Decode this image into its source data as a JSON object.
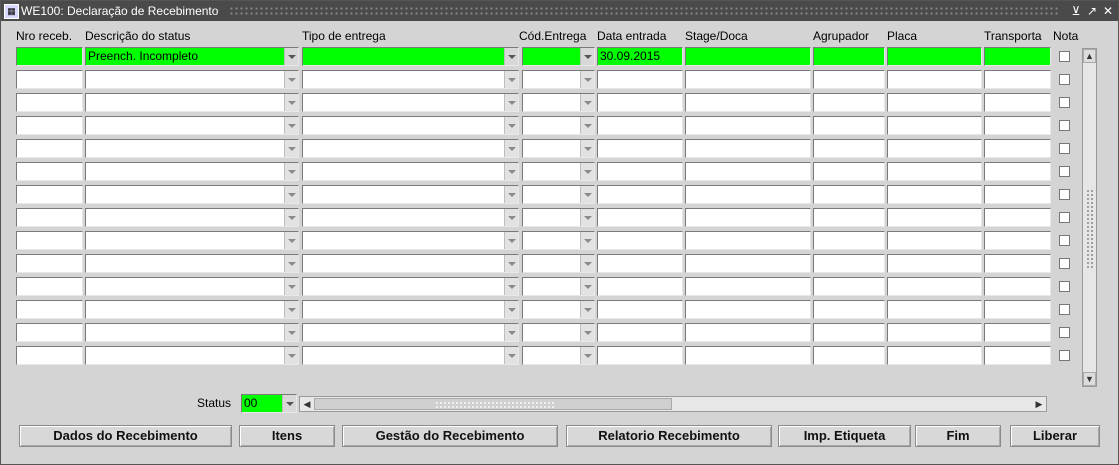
{
  "window": {
    "title": "WE100: Declaração de Recebimento",
    "app_icon": "form-icon",
    "controls": [
      "minimize-icon",
      "restore-icon",
      "close-icon"
    ]
  },
  "grid": {
    "columns": [
      "Nro receb.",
      "Descrição do status",
      "Tipo de entrega",
      "Cód.Entrega",
      "Data entrada",
      "Stage/Doca",
      "Agrupador",
      "Placa",
      "Transporta",
      "Nota"
    ],
    "rows": [
      {
        "nro": "",
        "status": "Preench. Incompleto",
        "tipo": "",
        "cod": "",
        "data": "30.09.2015",
        "stage": "",
        "agrupador": "",
        "placa": "",
        "transporta": "",
        "nota": false,
        "active": true
      },
      {
        "nro": "",
        "status": "",
        "tipo": "",
        "cod": "",
        "data": "",
        "stage": "",
        "agrupador": "",
        "placa": "",
        "transporta": "",
        "nota": false
      },
      {
        "nro": "",
        "status": "",
        "tipo": "",
        "cod": "",
        "data": "",
        "stage": "",
        "agrupador": "",
        "placa": "",
        "transporta": "",
        "nota": false
      },
      {
        "nro": "",
        "status": "",
        "tipo": "",
        "cod": "",
        "data": "",
        "stage": "",
        "agrupador": "",
        "placa": "",
        "transporta": "",
        "nota": false
      },
      {
        "nro": "",
        "status": "",
        "tipo": "",
        "cod": "",
        "data": "",
        "stage": "",
        "agrupador": "",
        "placa": "",
        "transporta": "",
        "nota": false
      },
      {
        "nro": "",
        "status": "",
        "tipo": "",
        "cod": "",
        "data": "",
        "stage": "",
        "agrupador": "",
        "placa": "",
        "transporta": "",
        "nota": false
      },
      {
        "nro": "",
        "status": "",
        "tipo": "",
        "cod": "",
        "data": "",
        "stage": "",
        "agrupador": "",
        "placa": "",
        "transporta": "",
        "nota": false
      },
      {
        "nro": "",
        "status": "",
        "tipo": "",
        "cod": "",
        "data": "",
        "stage": "",
        "agrupador": "",
        "placa": "",
        "transporta": "",
        "nota": false
      },
      {
        "nro": "",
        "status": "",
        "tipo": "",
        "cod": "",
        "data": "",
        "stage": "",
        "agrupador": "",
        "placa": "",
        "transporta": "",
        "nota": false
      },
      {
        "nro": "",
        "status": "",
        "tipo": "",
        "cod": "",
        "data": "",
        "stage": "",
        "agrupador": "",
        "placa": "",
        "transporta": "",
        "nota": false
      },
      {
        "nro": "",
        "status": "",
        "tipo": "",
        "cod": "",
        "data": "",
        "stage": "",
        "agrupador": "",
        "placa": "",
        "transporta": "",
        "nota": false
      },
      {
        "nro": "",
        "status": "",
        "tipo": "",
        "cod": "",
        "data": "",
        "stage": "",
        "agrupador": "",
        "placa": "",
        "transporta": "",
        "nota": false
      },
      {
        "nro": "",
        "status": "",
        "tipo": "",
        "cod": "",
        "data": "",
        "stage": "",
        "agrupador": "",
        "placa": "",
        "transporta": "",
        "nota": false
      },
      {
        "nro": "",
        "status": "",
        "tipo": "",
        "cod": "",
        "data": "",
        "stage": "",
        "agrupador": "",
        "placa": "",
        "transporta": "",
        "nota": false
      }
    ]
  },
  "footer": {
    "status_label": "Status",
    "status_value": "00"
  },
  "buttons": [
    "Dados do Recebimento",
    "Itens",
    "Gestão do Recebimento",
    "Relatorio Recebimento",
    "Imp. Etiqueta",
    "Fim",
    "Liberar"
  ],
  "colors": {
    "active_field": "#00ff00",
    "titlebar": "#4a4a4a",
    "background": "#d4d4d4"
  }
}
